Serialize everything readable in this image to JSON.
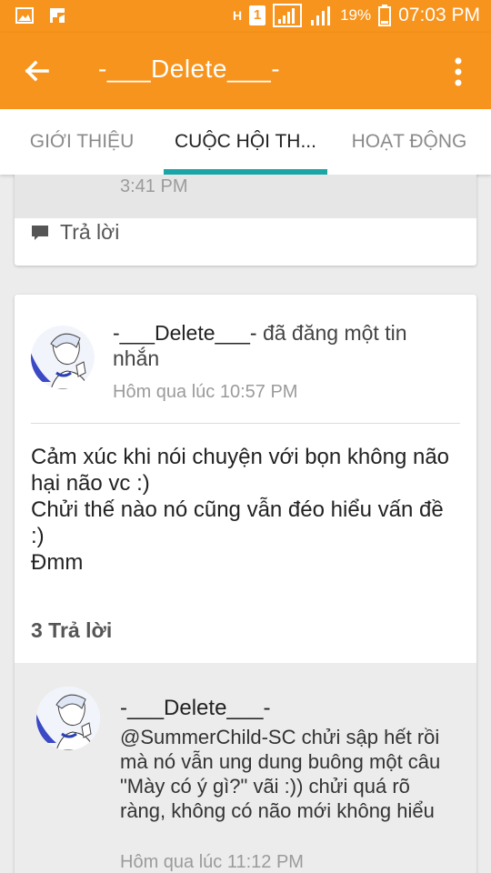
{
  "status_bar": {
    "battery": "19%",
    "time": "07:03 PM",
    "network_h": "H",
    "sim": "1"
  },
  "app_bar": {
    "title": "-___Delete___-"
  },
  "tabs": [
    {
      "label": "GIỚI THIỆU",
      "active": false
    },
    {
      "label": "CUỘC HỘI TH...",
      "active": true
    },
    {
      "label": "HOẠT ĐỘNG",
      "active": false
    }
  ],
  "prev_card": {
    "time": "3:41 PM",
    "reply_label": "Trả lời"
  },
  "post": {
    "author": "-___Delete___-",
    "action": "đã đăng một tin nhắn",
    "time": "Hôm qua lúc 10:57 PM",
    "body_lines": [
      "Cảm xúc khi nói chuyện với bọn không não hại não vc :)",
      "Chửi thế nào nó cũng vẫn đéo hiểu vấn đề :)",
      "Đmm"
    ],
    "reply_count": "3 Trả lời"
  },
  "reply": {
    "author": "-___Delete___-",
    "text": "@SummerChild-SC  chửi sập hết rồi mà nó vẫn ung dung buông một câu \"Mày có ý gì?\" vãi :)) chửi quá rõ ràng, không có não mới không hiểu",
    "time": "Hôm qua lúc 11:12 PM"
  },
  "colors": {
    "accent": "#f7941d",
    "tab_indicator": "#1aa6a6"
  }
}
